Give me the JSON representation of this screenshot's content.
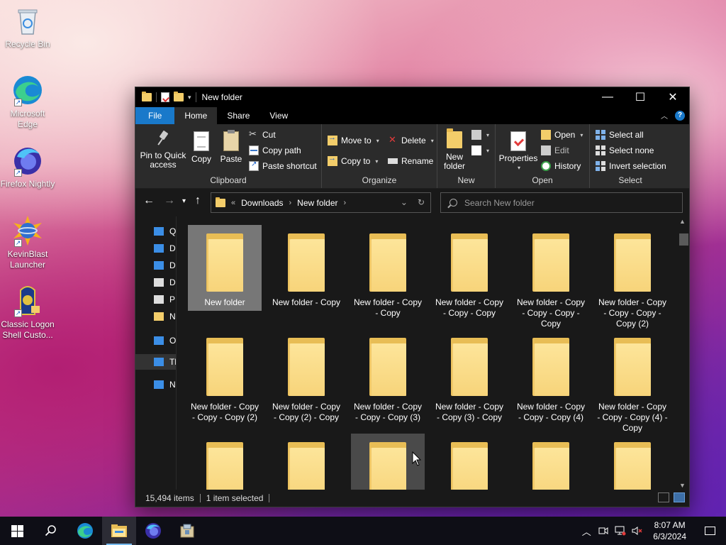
{
  "desktop": {
    "icons": [
      {
        "label": "Recycle Bin"
      },
      {
        "label": "Microsoft Edge"
      },
      {
        "label": "Firefox Nightly"
      },
      {
        "label": "KevinBlast Launcher"
      },
      {
        "label": "Classic Logon Shell Custo..."
      }
    ]
  },
  "window": {
    "title": "New folder",
    "tabs": [
      "File",
      "Home",
      "Share",
      "View"
    ],
    "ribbon": {
      "clipboard": {
        "pin": "Pin to Quick access",
        "copy": "Copy",
        "paste": "Paste",
        "cut": "Cut",
        "copy_path": "Copy path",
        "paste_shortcut": "Paste shortcut",
        "group": "Clipboard"
      },
      "organize": {
        "move_to": "Move to",
        "copy_to": "Copy to",
        "delete": "Delete",
        "rename": "Rename",
        "group": "Organize"
      },
      "new": {
        "new_folder": "New folder",
        "group": "New"
      },
      "open": {
        "properties": "Properties",
        "open": "Open",
        "edit": "Edit",
        "history": "History",
        "group": "Open"
      },
      "select": {
        "select_all": "Select all",
        "select_none": "Select none",
        "invert": "Invert selection",
        "group": "Select"
      }
    },
    "address": {
      "overflow": "«",
      "crumbs": [
        "Downloads",
        "New folder"
      ]
    },
    "search": {
      "placeholder": "Search New folder"
    },
    "navpane": [
      {
        "label": "Q",
        "icon": "star-icon",
        "color": "#3b8ee6"
      },
      {
        "label": "D",
        "icon": "desktop-icon",
        "color": "#3b8ee6"
      },
      {
        "label": "D",
        "icon": "download-icon",
        "color": "#3b8ee6"
      },
      {
        "label": "D",
        "icon": "documents-icon",
        "color": "#dddddd"
      },
      {
        "label": "P",
        "icon": "pictures-icon",
        "color": "#dddddd"
      },
      {
        "label": "N",
        "icon": "folder-icon",
        "color": "#f3cd6a"
      },
      {
        "label": "Or",
        "icon": "onedrive-icon",
        "color": "#3b8ee6"
      },
      {
        "label": "Th",
        "icon": "this-pc-icon",
        "color": "#3b8ee6"
      },
      {
        "label": "Ne",
        "icon": "network-icon",
        "color": "#3b8ee6"
      }
    ],
    "items": [
      "New folder",
      "New folder - Copy",
      "New folder - Copy - Copy",
      "New folder - Copy - Copy - Copy",
      "New folder - Copy - Copy - Copy - Copy",
      "New folder - Copy - Copy - Copy - Copy (2)",
      "New folder - Copy - Copy - Copy (2)",
      "New folder - Copy - Copy (2) - Copy",
      "New folder - Copy - Copy - Copy (3)",
      "New folder - Copy - Copy (3) - Copy",
      "New folder - Copy - Copy - Copy (4)",
      "New folder - Copy - Copy - Copy (4) - Copy",
      "",
      "",
      "",
      "",
      "",
      ""
    ],
    "selected_index": 0,
    "hover_index": 14,
    "status": {
      "count": "15,494 items",
      "selected": "1 item selected"
    }
  },
  "taskbar": {
    "time": "8:07 AM",
    "date": "6/3/2024"
  },
  "colors": {
    "accent": "#1979ca",
    "folder": "#f7d47a",
    "window_bg": "#191919"
  }
}
